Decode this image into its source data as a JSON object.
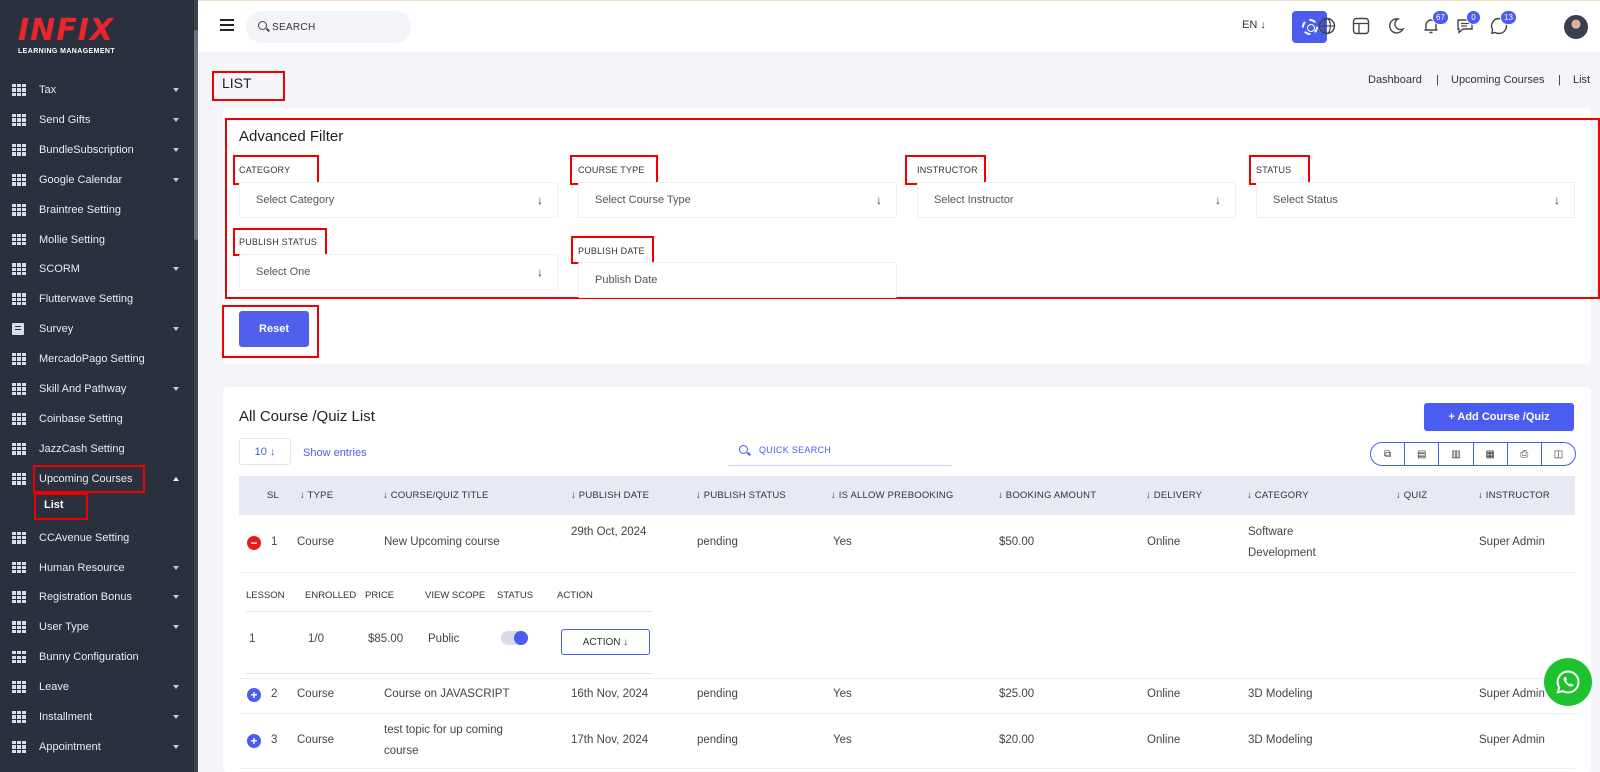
{
  "app": {
    "logo_main": "INFIX",
    "logo_sub": "LEARNING MANAGEMENT"
  },
  "sidebar": {
    "items": [
      {
        "label": "Tax",
        "caret": true
      },
      {
        "label": "Send Gifts",
        "caret": true
      },
      {
        "label": "BundleSubscription",
        "caret": true
      },
      {
        "label": "Google Calendar",
        "caret": true
      },
      {
        "label": "Braintree Setting",
        "caret": false
      },
      {
        "label": "Mollie Setting",
        "caret": false
      },
      {
        "label": "SCORM",
        "caret": true
      },
      {
        "label": "Flutterwave Setting",
        "caret": false
      },
      {
        "label": "Survey",
        "caret": true
      },
      {
        "label": "MercadoPago Setting",
        "caret": false
      },
      {
        "label": "Skill And Pathway",
        "caret": true
      },
      {
        "label": "Coinbase Setting",
        "caret": false
      },
      {
        "label": "JazzCash Setting",
        "caret": false
      },
      {
        "label": "Upcoming Courses",
        "caret": true,
        "active": true
      },
      {
        "label": "CCAvenue Setting",
        "caret": false
      },
      {
        "label": "Human Resource",
        "caret": true
      },
      {
        "label": "Registration Bonus",
        "caret": true
      },
      {
        "label": "User Type",
        "caret": true
      },
      {
        "label": "Bunny Configuration",
        "caret": false
      },
      {
        "label": "Leave",
        "caret": true
      },
      {
        "label": "Installment",
        "caret": true
      },
      {
        "label": "Appointment",
        "caret": true
      }
    ],
    "sub_item": "List"
  },
  "topbar": {
    "search_placeholder": "SEARCH",
    "language": "EN ↓",
    "badges": {
      "notifications": "67",
      "messages": "0",
      "whatsapp": "13"
    }
  },
  "page": {
    "title": "LIST",
    "breadcrumb": [
      "Dashboard",
      "|",
      "Upcoming Courses",
      "|",
      "List"
    ]
  },
  "filter": {
    "title": "Advanced Filter",
    "category_label": "CATEGORY",
    "category_placeholder": "Select Category",
    "course_type_label": "COURSE TYPE",
    "course_type_placeholder": "Select Course Type",
    "instructor_label": "INSTRUCTOR",
    "instructor_placeholder": "Select Instructor",
    "status_label": "STATUS",
    "status_placeholder": "Select Status",
    "publish_status_label": "PUBLISH STATUS",
    "publish_status_placeholder": "Select One",
    "publish_date_label": "PUBLISH DATE",
    "publish_date_placeholder": "Publish Date",
    "reset_label": "Reset"
  },
  "list": {
    "title": "All Course /Quiz List",
    "add_button": "+ Add Course /Quiz",
    "entries_value": "10 ↓",
    "show_entries": "Show entries",
    "quick_search": "QUICK SEARCH",
    "headers": {
      "sl": "SL",
      "type": "↓ TYPE",
      "title": "↓ COURSE/QUIZ TITLE",
      "publish_date": "↓ PUBLISH DATE",
      "publish_status": "↓ PUBLISH STATUS",
      "prebooking": "↓ IS ALLOW PREBOOKING",
      "booking_amount": "↓ BOOKING AMOUNT",
      "delivery": "↓ DELIVERY",
      "category": "↓ CATEGORY",
      "quiz": "↓ QUIZ",
      "instructor": "↓ INSTRUCTOR"
    },
    "rows": [
      {
        "sl": "1",
        "type": "Course",
        "title": "New Upcoming course",
        "publish_date": "29th Oct, 2024",
        "publish_status": "pending",
        "prebooking": "Yes",
        "booking_amount": "$50.00",
        "delivery": "Online",
        "category": "Software Development",
        "quiz": "",
        "instructor": "Super Admin",
        "expanded": true
      },
      {
        "sl": "2",
        "type": "Course",
        "title": "Course on JAVASCRIPT",
        "publish_date": "16th Nov, 2024",
        "publish_status": "pending",
        "prebooking": "Yes",
        "booking_amount": "$25.00",
        "delivery": "Online",
        "category": "3D Modeling",
        "quiz": "",
        "instructor": "Super Admin",
        "expanded": false
      },
      {
        "sl": "3",
        "type": "Course",
        "title": "test topic for up coming course",
        "publish_date": "17th Nov, 2024",
        "publish_status": "pending",
        "prebooking": "Yes",
        "booking_amount": "$20.00",
        "delivery": "Online",
        "category": "3D Modeling",
        "quiz": "",
        "instructor": "Super Admin",
        "expanded": false
      }
    ],
    "detail": {
      "headers": {
        "lesson": "LESSON",
        "enrolled": "ENROLLED",
        "price": "PRICE",
        "view_scope": "VIEW SCOPE",
        "status": "STATUS",
        "action": "ACTION"
      },
      "values": {
        "lesson": "1",
        "enrolled": "1/0",
        "price": "$85.00",
        "view_scope": "Public",
        "status_on": true,
        "action_label": "ACTION ↓"
      }
    }
  },
  "colors": {
    "accent": "#4b5cf0",
    "sidebar_bg": "#2a303d",
    "highlight": "#e00000",
    "whatsapp": "#1ec22e"
  }
}
